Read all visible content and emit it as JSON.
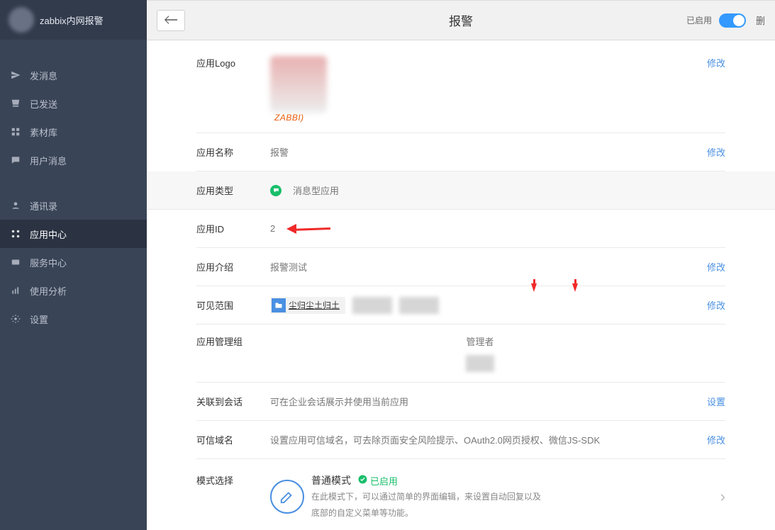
{
  "sidebar": {
    "title": "zabbix内网报警",
    "items": [
      {
        "label": "发消息"
      },
      {
        "label": "已发送"
      },
      {
        "label": "素材库"
      },
      {
        "label": "用户消息"
      },
      {
        "label": "通讯录"
      },
      {
        "label": "应用中心"
      },
      {
        "label": "服务中心"
      },
      {
        "label": "使用分析"
      },
      {
        "label": "设置"
      }
    ]
  },
  "topbar": {
    "title": "报警",
    "enabled_label": "已启用",
    "delete_partial": "删"
  },
  "form": {
    "logo_label": "应用Logo",
    "logo_text": "ZABBI)",
    "name_label": "应用名称",
    "name_value": "报警",
    "type_label": "应用类型",
    "type_value": "消息型应用",
    "id_label": "应用ID",
    "id_value": "2",
    "intro_label": "应用介绍",
    "intro_value": "报警测试",
    "scope_label": "可见范围",
    "scope_chip_text": "尘归尘土归土",
    "admin_group_label": "应用管理组",
    "admin_group_value": "管理者",
    "session_label": "关联到会话",
    "session_value": "可在企业会话展示并使用当前应用",
    "domain_label": "可信域名",
    "domain_value": "设置应用可信域名，可去除页面安全风险提示、OAuth2.0网页授权、微信JS-SDK",
    "mode_label": "模式选择",
    "mode_title": "普通模式",
    "mode_status": "已启用",
    "mode_desc_1": "在此模式下，可以通过简单的界面编辑，来设置自动回复以及",
    "mode_desc_2": "底部的自定义菜单等功能。"
  },
  "actions": {
    "modify": "修改",
    "settings": "设置"
  }
}
